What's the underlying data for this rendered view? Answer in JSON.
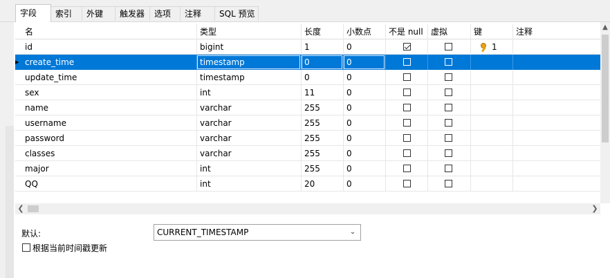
{
  "tabs": [
    {
      "label": "字段",
      "active": true
    },
    {
      "label": "索引",
      "active": false
    },
    {
      "label": "外键",
      "active": false
    },
    {
      "label": "触发器",
      "active": false
    },
    {
      "label": "选项",
      "active": false
    },
    {
      "label": "注释",
      "active": false
    },
    {
      "label": "SQL 预览",
      "active": false
    }
  ],
  "columns": {
    "name": "名",
    "type": "类型",
    "length": "长度",
    "decimals": "小数点",
    "not_null": "不是 null",
    "virtual": "虚拟",
    "key": "键",
    "comment": "注释"
  },
  "rows": [
    {
      "name": "id",
      "type": "bigint",
      "length": "1",
      "decimals": "0",
      "not_null": true,
      "virtual": false,
      "key": "1",
      "selected": false
    },
    {
      "name": "create_time",
      "type": "timestamp",
      "length": "0",
      "decimals": "0",
      "not_null": false,
      "virtual": false,
      "key": "",
      "selected": true
    },
    {
      "name": "update_time",
      "type": "timestamp",
      "length": "0",
      "decimals": "0",
      "not_null": false,
      "virtual": false,
      "key": "",
      "selected": false
    },
    {
      "name": "sex",
      "type": "int",
      "length": "11",
      "decimals": "0",
      "not_null": false,
      "virtual": false,
      "key": "",
      "selected": false
    },
    {
      "name": "name",
      "type": "varchar",
      "length": "255",
      "decimals": "0",
      "not_null": false,
      "virtual": false,
      "key": "",
      "selected": false
    },
    {
      "name": "username",
      "type": "varchar",
      "length": "255",
      "decimals": "0",
      "not_null": false,
      "virtual": false,
      "key": "",
      "selected": false
    },
    {
      "name": "password",
      "type": "varchar",
      "length": "255",
      "decimals": "0",
      "not_null": false,
      "virtual": false,
      "key": "",
      "selected": false
    },
    {
      "name": "classes",
      "type": "varchar",
      "length": "255",
      "decimals": "0",
      "not_null": false,
      "virtual": false,
      "key": "",
      "selected": false
    },
    {
      "name": "major",
      "type": "int",
      "length": "255",
      "decimals": "0",
      "not_null": false,
      "virtual": false,
      "key": "",
      "selected": false
    },
    {
      "name": "QQ",
      "type": "int",
      "length": "20",
      "decimals": "0",
      "not_null": false,
      "virtual": false,
      "key": "",
      "selected": false
    }
  ],
  "properties": {
    "default_label": "默认:",
    "default_value": "CURRENT_TIMESTAMP",
    "update_label": "根据当前时间戳更新",
    "update_checked": false
  },
  "icons": {
    "row_pointer": "row-pointer-icon",
    "key": "key-icon",
    "dropdown": "chevron-down-icon"
  },
  "colors": {
    "selection": "#0078d7",
    "key": "#e8a317"
  }
}
